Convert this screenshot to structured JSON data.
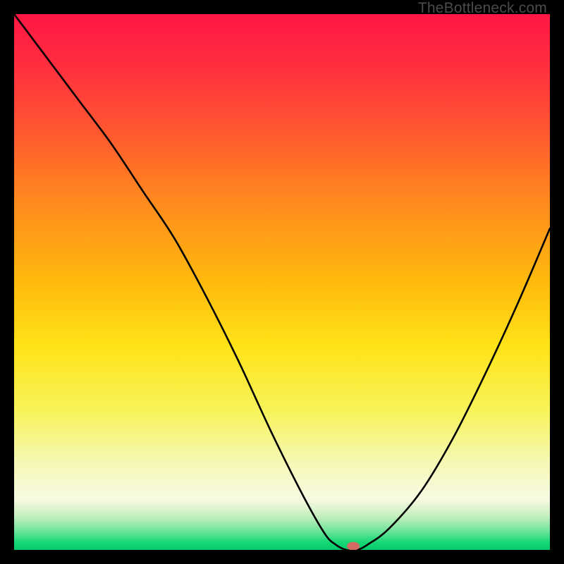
{
  "watermark": "TheBottleneck.com",
  "chart_data": {
    "type": "line",
    "title": "",
    "xlabel": "",
    "ylabel": "",
    "xlim": [
      0,
      100
    ],
    "ylim": [
      0,
      100
    ],
    "x": [
      0,
      6,
      12,
      18,
      24,
      30,
      36,
      42,
      48,
      54,
      58,
      60,
      62,
      64,
      66,
      70,
      76,
      82,
      88,
      94,
      100
    ],
    "y": [
      100,
      92,
      84,
      76,
      67,
      58,
      47,
      35,
      22,
      10,
      3,
      1,
      0,
      0,
      1,
      4,
      11,
      21,
      33,
      46,
      60
    ],
    "marker": {
      "x": 63.3,
      "y": 0.7,
      "color": "#d36a63",
      "rx": 9,
      "ry": 6
    },
    "gradient_stops": [
      {
        "offset": 0.0,
        "color": "#ff1744"
      },
      {
        "offset": 0.1,
        "color": "#ff2f3f"
      },
      {
        "offset": 0.22,
        "color": "#ff5830"
      },
      {
        "offset": 0.35,
        "color": "#ff8a1e"
      },
      {
        "offset": 0.5,
        "color": "#ffba0d"
      },
      {
        "offset": 0.62,
        "color": "#ffe318"
      },
      {
        "offset": 0.74,
        "color": "#f7f35a"
      },
      {
        "offset": 0.84,
        "color": "#f6f8b7"
      },
      {
        "offset": 0.905,
        "color": "#f7fae2"
      },
      {
        "offset": 0.935,
        "color": "#c9f0c1"
      },
      {
        "offset": 0.965,
        "color": "#6fe39b"
      },
      {
        "offset": 0.985,
        "color": "#18d977"
      },
      {
        "offset": 1.0,
        "color": "#04c96a"
      }
    ],
    "line_color": "#000000",
    "line_width": 2.6
  }
}
